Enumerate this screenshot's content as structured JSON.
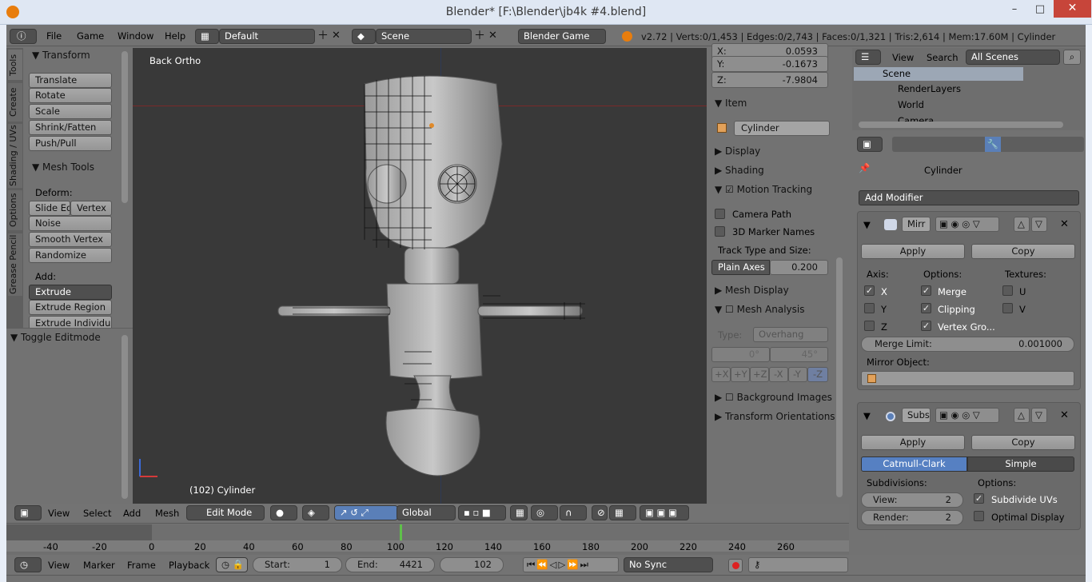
{
  "window": {
    "title": "Blender* [F:\\Blender\\jb4k #4.blend]",
    "minimize": "–",
    "maximize": "□",
    "close": "✕"
  },
  "info_header": {
    "menus": [
      "File",
      "Game",
      "Window",
      "Help"
    ],
    "screen_layout": "Default",
    "scene": "Scene",
    "engine": "Blender Game",
    "stats": "v2.72 | Verts:0/1,453 | Edges:0/2,743 | Faces:0/1,321 | Tris:2,614 | Mem:17.60M | Cylinder"
  },
  "toolshelf": {
    "tabs": [
      "Tools",
      "Create",
      "Shading / UVs",
      "Options",
      "Grease Pencil"
    ],
    "transform_title": "Transform",
    "transform_buttons": [
      "Translate",
      "Rotate",
      "Scale",
      "Shrink/Fatten",
      "Push/Pull"
    ],
    "meshtools_title": "Mesh Tools",
    "deform_label": "Deform:",
    "deform_row1": [
      "Slide Ed",
      "Vertex"
    ],
    "deform_buttons": [
      "Noise",
      "Smooth Vertex",
      "Randomize"
    ],
    "add_label": "Add:",
    "extrude": "Extrude",
    "add_buttons": [
      "Extrude Region",
      "Extrude Individual"
    ],
    "toggle_editmode": "Toggle Editmode"
  },
  "viewport": {
    "view_name": "Back Ortho",
    "object_info": "(102) Cylinder"
  },
  "properties_n": {
    "coords": [
      {
        "label": "X:",
        "value": "0.0593"
      },
      {
        "label": "Y:",
        "value": "-0.1673"
      },
      {
        "label": "Z:",
        "value": "-7.9804"
      }
    ],
    "item_title": "Item",
    "item_name": "Cylinder",
    "display": "Display",
    "shading": "Shading",
    "motion_tracking": "Motion Tracking",
    "camera_path": "Camera Path",
    "marker_names": "3D Marker Names",
    "track_type_label": "Track Type and Size:",
    "track_type": "Plain Axes",
    "track_size": "0.200",
    "mesh_display": "Mesh Display",
    "mesh_analysis": "Mesh Analysis",
    "type_label": "Type:",
    "type_value": "Overhang",
    "angle_min": "0°",
    "angle_max": "45°",
    "axes": [
      "+X",
      "+Y",
      "+Z",
      "-X",
      "-Y",
      "-Z"
    ],
    "background_images": "Background Images",
    "transform_orientations": "Transform Orientations"
  },
  "outliner": {
    "menus": [
      "View",
      "Search"
    ],
    "filter": "All Scenes",
    "items": [
      "Scene",
      "RenderLayers",
      "World",
      "Camera"
    ]
  },
  "modifiers": {
    "breadcrumb": "Cylinder",
    "add_modifier": "Add Modifier",
    "mirror": {
      "name": "Mirr",
      "apply": "Apply",
      "copy": "Copy",
      "axis_label": "Axis:",
      "options_label": "Options:",
      "textures_label": "Textures:",
      "axes": [
        {
          "label": "X",
          "checked": true
        },
        {
          "label": "Y",
          "checked": false
        },
        {
          "label": "Z",
          "checked": false
        }
      ],
      "options": [
        {
          "label": "Merge",
          "checked": true
        },
        {
          "label": "Clipping",
          "checked": true
        },
        {
          "label": "Vertex Gro...",
          "checked": true
        }
      ],
      "textures": [
        {
          "label": "U",
          "checked": false
        },
        {
          "label": "V",
          "checked": false
        }
      ],
      "merge_limit_label": "Merge Limit:",
      "merge_limit": "0.001000",
      "mirror_object_label": "Mirror Object:"
    },
    "subsurf": {
      "name": "Subs",
      "apply": "Apply",
      "copy": "Copy",
      "catmull": "Catmull-Clark",
      "simple": "Simple",
      "subdivisions_label": "Subdivisions:",
      "options_label": "Options:",
      "view_label": "View:",
      "view_value": "2",
      "render_label": "Render:",
      "render_value": "2",
      "subdivide_uvs": "Subdivide UVs",
      "optimal_display": "Optimal Display"
    }
  },
  "view3d_header": {
    "menus": [
      "View",
      "Select",
      "Add",
      "Mesh"
    ],
    "mode": "Edit Mode",
    "orientation": "Global"
  },
  "timeline": {
    "ticks": [
      "-40",
      "-20",
      "0",
      "20",
      "40",
      "60",
      "80",
      "100",
      "120",
      "140",
      "160",
      "180",
      "200",
      "220",
      "240",
      "260"
    ],
    "menus": [
      "View",
      "Marker",
      "Frame",
      "Playback"
    ],
    "start_label": "Start:",
    "start": "1",
    "end_label": "End:",
    "end": "4421",
    "current": "102",
    "sync": "No Sync"
  }
}
